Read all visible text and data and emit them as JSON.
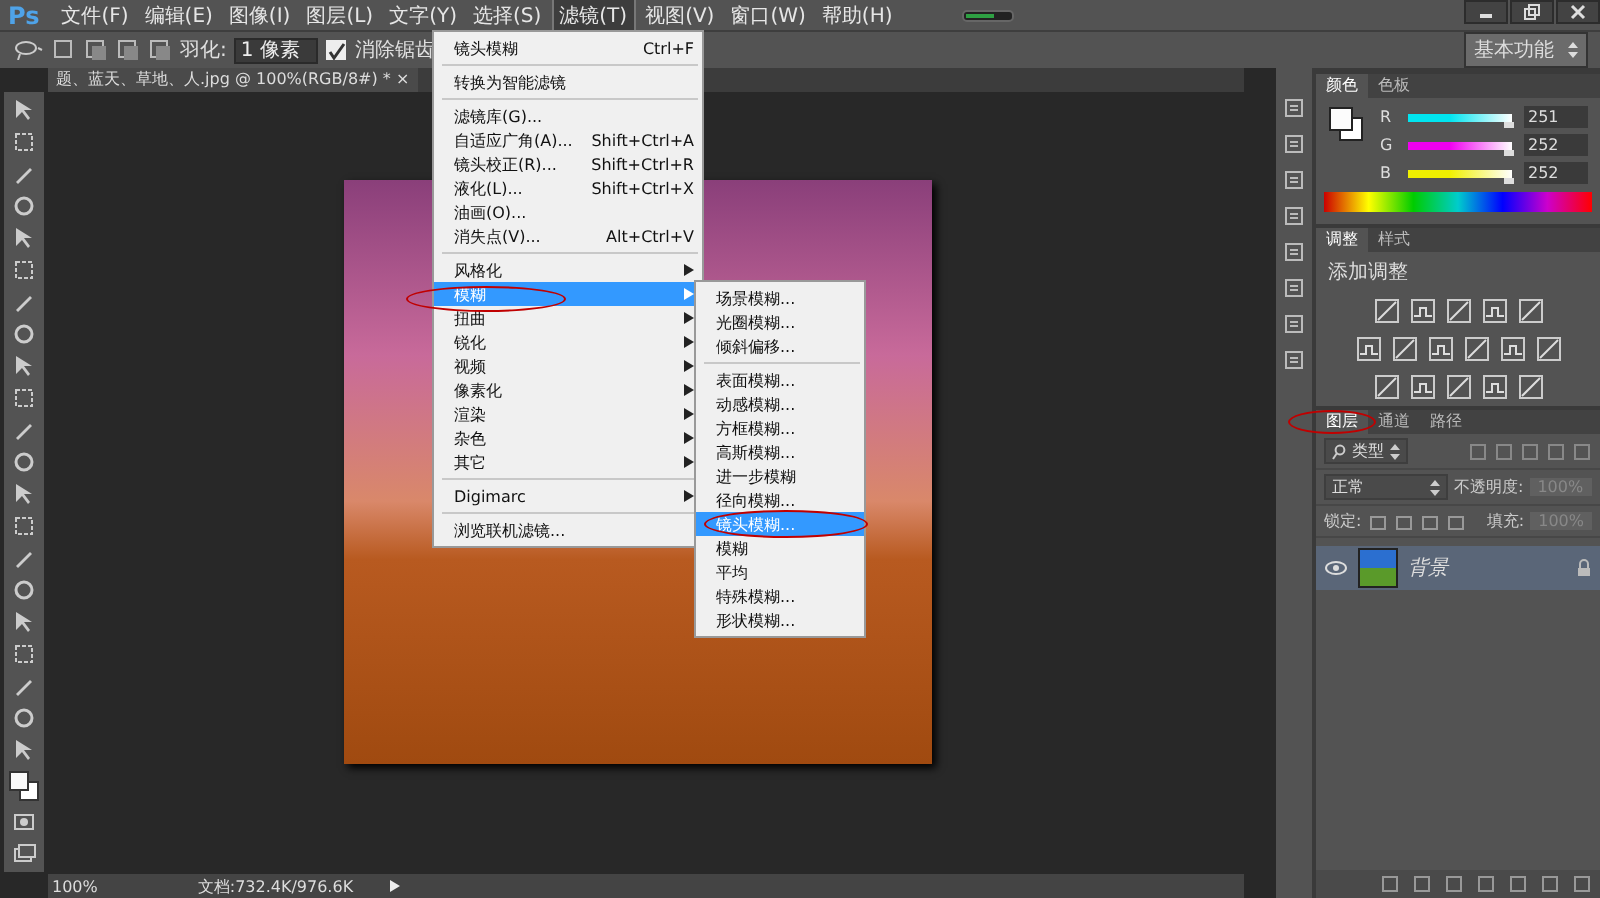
{
  "app_logo": "Ps",
  "menu_bar": [
    {
      "label": "文件(F)",
      "selected": false
    },
    {
      "label": "编辑(E)",
      "selected": false
    },
    {
      "label": "图像(I)",
      "selected": false
    },
    {
      "label": "图层(L)",
      "selected": false
    },
    {
      "label": "文字(Y)",
      "selected": false
    },
    {
      "label": "选择(S)",
      "selected": false
    },
    {
      "label": "滤镜(T)",
      "selected": true
    },
    {
      "label": "视图(V)",
      "selected": false
    },
    {
      "label": "窗口(W)",
      "selected": false
    },
    {
      "label": "帮助(H)",
      "selected": false
    }
  ],
  "options_bar": {
    "feather_label": "羽化:",
    "feather_value": "1 像素",
    "anti_alias": {
      "label": "消除锯齿",
      "checked": true
    },
    "workspace": "基本功能"
  },
  "document_tab": {
    "title": "题、蓝天、草地、人.jpg @ 100%(RGB/8#) *",
    "close": "×"
  },
  "filter_menu": [
    {
      "kind": "item",
      "label": "镜头模糊",
      "shortcut": "Ctrl+F",
      "submenu": false,
      "selected": false
    },
    {
      "kind": "separator"
    },
    {
      "kind": "item",
      "label": "转换为智能滤镜",
      "submenu": false,
      "selected": false
    },
    {
      "kind": "separator"
    },
    {
      "kind": "item",
      "label": "滤镜库(G)...",
      "submenu": false,
      "selected": false
    },
    {
      "kind": "item",
      "label": "自适应广角(A)...",
      "shortcut": "Shift+Ctrl+A",
      "submenu": false,
      "selected": false
    },
    {
      "kind": "item",
      "label": "镜头校正(R)...",
      "shortcut": "Shift+Ctrl+R",
      "submenu": false,
      "selected": false
    },
    {
      "kind": "item",
      "label": "液化(L)...",
      "shortcut": "Shift+Ctrl+X",
      "submenu": false,
      "selected": false
    },
    {
      "kind": "item",
      "label": "油画(O)...",
      "submenu": false,
      "selected": false
    },
    {
      "kind": "item",
      "label": "消失点(V)...",
      "shortcut": "Alt+Ctrl+V",
      "submenu": false,
      "selected": false
    },
    {
      "kind": "separator"
    },
    {
      "kind": "item",
      "label": "风格化",
      "submenu": true,
      "selected": false
    },
    {
      "kind": "item",
      "label": "模糊",
      "submenu": true,
      "selected": true
    },
    {
      "kind": "item",
      "label": "扭曲",
      "submenu": true,
      "selected": false
    },
    {
      "kind": "item",
      "label": "锐化",
      "submenu": true,
      "selected": false
    },
    {
      "kind": "item",
      "label": "视频",
      "submenu": true,
      "selected": false
    },
    {
      "kind": "item",
      "label": "像素化",
      "submenu": true,
      "selected": false
    },
    {
      "kind": "item",
      "label": "渲染",
      "submenu": true,
      "selected": false
    },
    {
      "kind": "item",
      "label": "杂色",
      "submenu": true,
      "selected": false
    },
    {
      "kind": "item",
      "label": "其它",
      "submenu": true,
      "selected": false
    },
    {
      "kind": "separator"
    },
    {
      "kind": "item",
      "label": "Digimarc",
      "submenu": true,
      "selected": false
    },
    {
      "kind": "separator"
    },
    {
      "kind": "item",
      "label": "浏览联机滤镜...",
      "submenu": false,
      "selected": false
    }
  ],
  "blur_submenu": [
    {
      "kind": "item",
      "label": "场景模糊...",
      "selected": false
    },
    {
      "kind": "item",
      "label": "光圈模糊...",
      "selected": false
    },
    {
      "kind": "item",
      "label": "倾斜偏移...",
      "selected": false
    },
    {
      "kind": "separator"
    },
    {
      "kind": "item",
      "label": "表面模糊...",
      "selected": false
    },
    {
      "kind": "item",
      "label": "动感模糊...",
      "selected": false
    },
    {
      "kind": "item",
      "label": "方框模糊...",
      "selected": false
    },
    {
      "kind": "item",
      "label": "高斯模糊...",
      "selected": false
    },
    {
      "kind": "item",
      "label": "进一步模糊",
      "selected": false
    },
    {
      "kind": "item",
      "label": "径向模糊...",
      "selected": false
    },
    {
      "kind": "item",
      "label": "镜头模糊...",
      "selected": true
    },
    {
      "kind": "item",
      "label": "模糊",
      "selected": false
    },
    {
      "kind": "item",
      "label": "平均",
      "selected": false
    },
    {
      "kind": "item",
      "label": "特殊模糊...",
      "selected": false
    },
    {
      "kind": "item",
      "label": "形状模糊...",
      "selected": false
    }
  ],
  "color_panel": {
    "tabs": [
      {
        "label": "颜色",
        "selected": true
      },
      {
        "label": "色板",
        "selected": false
      }
    ],
    "channels": [
      {
        "name": "R",
        "value": "251",
        "level": 0.98,
        "color": "#00e5f0"
      },
      {
        "name": "G",
        "value": "252",
        "level": 0.98,
        "color": "#f000f0"
      },
      {
        "name": "B",
        "value": "252",
        "level": 0.98,
        "color": "#f0f000"
      }
    ]
  },
  "adjustments_panel": {
    "tabs": [
      {
        "label": "调整",
        "selected": true
      },
      {
        "label": "样式",
        "selected": false
      }
    ],
    "title": "添加调整"
  },
  "layers_panel": {
    "tabs": [
      {
        "label": "图层",
        "selected": true
      },
      {
        "label": "通道",
        "selected": false
      },
      {
        "label": "路径",
        "selected": false
      }
    ],
    "filter_kind": "类型",
    "blend_mode": "正常",
    "opacity_label": "不透明度:",
    "opacity": "100%",
    "lock_label": "锁定:",
    "fill_label": "填充:",
    "fill": "100%",
    "layers": [
      {
        "name": "背景",
        "visible": true,
        "locked": true,
        "selected": true
      }
    ]
  },
  "status_bar": {
    "zoom": "100%",
    "document_size": "文档:732.4K/976.6K"
  }
}
